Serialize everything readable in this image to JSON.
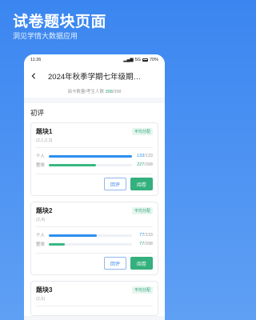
{
  "promo": {
    "title": "试卷题块页面",
    "subtitle": "洞见学情大数据应用"
  },
  "statusbar": {
    "time": "11:26",
    "signal": "5G",
    "battery": "70%"
  },
  "header": {
    "title": "2024年秋季学期七年级期…"
  },
  "summary": {
    "label": "阅卡数量/考生人数",
    "value": "398",
    "total": "/398"
  },
  "section": {
    "title": "初评"
  },
  "blocks": [
    {
      "name": "题块1",
      "code": "(2,1,2,3)",
      "tag": "平均分配",
      "personal_label": "个人",
      "personal_done": "133",
      "personal_total": "/133",
      "personal_progress": 1.0,
      "all_label": "整体",
      "all_done": "227",
      "all_total": "/398",
      "all_progress": 0.57,
      "review_label": "回评",
      "mark_label": "阅卷"
    },
    {
      "name": "题块2",
      "code": "(2,4)",
      "tag": "平均分配",
      "personal_label": "个人",
      "personal_done": "77",
      "personal_total": "/133",
      "personal_progress": 0.58,
      "all_label": "整体",
      "all_done": "77",
      "all_total": "/398",
      "all_progress": 0.19,
      "review_label": "回评",
      "mark_label": "阅卷"
    },
    {
      "name": "题块3",
      "code": "(2,6)",
      "tag": "平均分配"
    }
  ],
  "colors": {
    "accent": "#3a86f0",
    "green": "#33b07d",
    "bar_blue": "#2d8ef0"
  }
}
